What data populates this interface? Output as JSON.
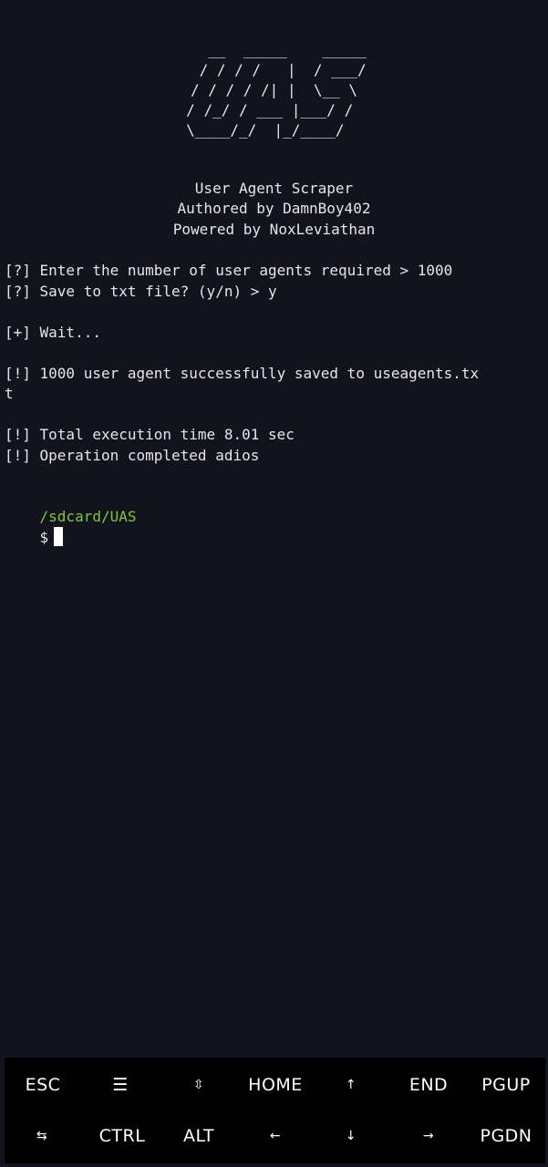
{
  "terminal": {
    "ascii_art": [
      "   __  _____    _____",
      "  / / / /   |  / ___/",
      " / / / / /| |  \\__ \\ ",
      "/ /_/ / ___ |___/ / ",
      "\\____/_/  |_/____/  "
    ],
    "banner": {
      "title": "User Agent Scraper",
      "author": "Authored by DamnBoy402",
      "powered": "Powered by NoxLeviathan"
    },
    "output": {
      "q1": "[?] Enter the number of user agents required > 1000",
      "q2": "[?] Save to txt file? (y/n) > y",
      "wait": "[+] Wait...",
      "saved_1": "[!] 1000 user agent successfully saved to useagents.tx",
      "saved_2": "t",
      "time": "[!] Total execution time 8.01 sec",
      "done": "[!] Operation completed adios"
    },
    "prompt": {
      "path": "/sdcard/UAS",
      "symbol": "$"
    }
  },
  "extra_keys": {
    "row1": [
      "ESC",
      "☰",
      "⇳",
      "HOME",
      "↑",
      "END",
      "PGUP"
    ],
    "row2": [
      "⇆",
      "CTRL",
      "ALT",
      "←",
      "↓",
      "→",
      "PGDN"
    ]
  },
  "colors": {
    "background": "#12131c",
    "text": "#e6e6e6",
    "prompt_path": "#7ec93a",
    "keybar": "#000000"
  }
}
